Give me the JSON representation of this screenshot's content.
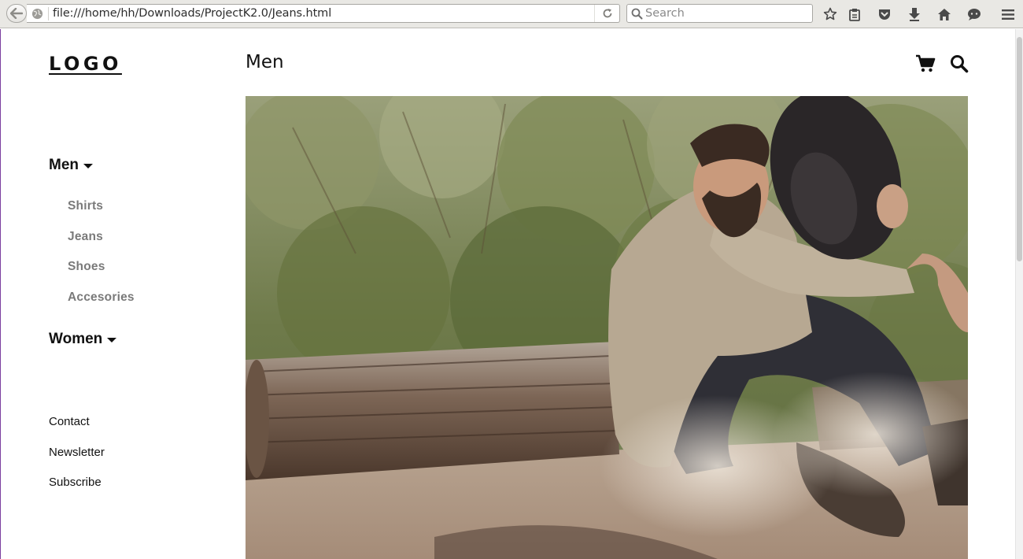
{
  "browser": {
    "url": "file:///home/hh/Downloads/ProjectK2.0/Jeans.html",
    "search_placeholder": "Search"
  },
  "site": {
    "logo": "LOGO",
    "page_title": "Men"
  },
  "sidebar": {
    "categories": [
      {
        "label": "Men",
        "expanded": true,
        "items": [
          "Shirts",
          "Jeans",
          "Shoes",
          "Accesories"
        ]
      },
      {
        "label": "Women",
        "expanded": false
      }
    ],
    "links": [
      "Contact",
      "Newsletter",
      "Subscribe"
    ]
  },
  "hero": {
    "description": ""
  }
}
